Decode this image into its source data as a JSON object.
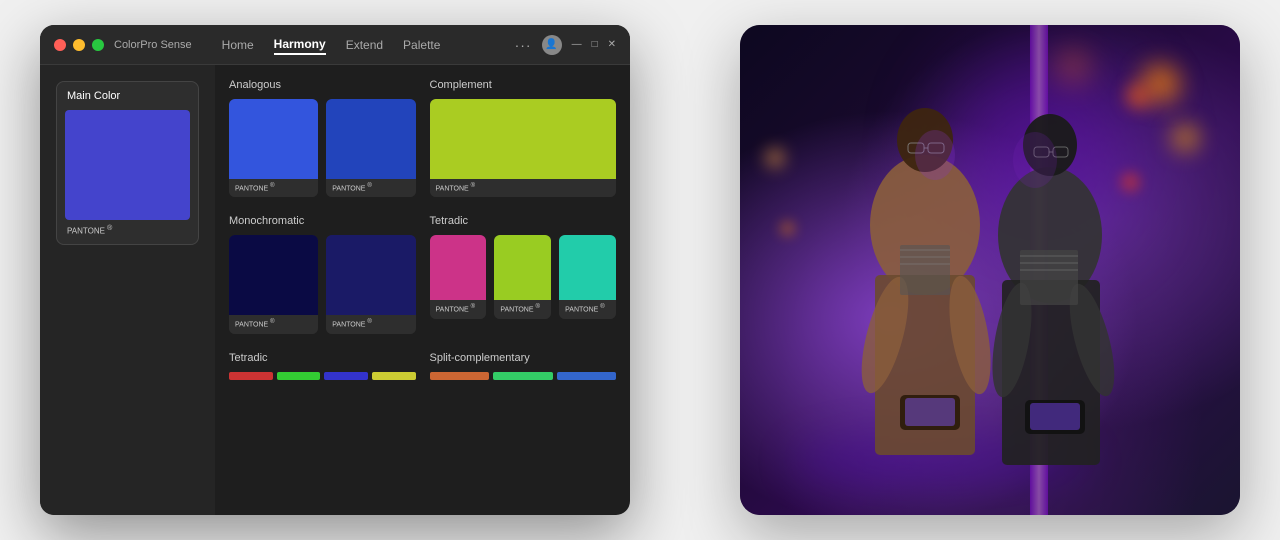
{
  "app": {
    "title": "ColorPro Sense",
    "nav": {
      "tabs": [
        {
          "label": "Home",
          "active": false
        },
        {
          "label": "Harmony",
          "active": true
        },
        {
          "label": "Extend",
          "active": false
        },
        {
          "label": "Palette",
          "active": false
        }
      ]
    },
    "window_controls": {
      "dots": "···"
    }
  },
  "sidebar": {
    "main_color_label": "Main Color",
    "pantone_label": "PANTONE",
    "pantone_reg": "®",
    "main_color": "#4444cc"
  },
  "sections": [
    {
      "id": "analogous",
      "title": "Analogous",
      "swatches": [
        {
          "color": "#3355dd",
          "pantone": "PANTONE",
          "reg": "®"
        },
        {
          "color": "#2244bb",
          "pantone": "PANTONE",
          "reg": "®"
        }
      ]
    },
    {
      "id": "complement",
      "title": "Complement",
      "swatches": [
        {
          "color": "#aacc22",
          "pantone": "PANTONE",
          "reg": "®"
        }
      ]
    },
    {
      "id": "monochromatic",
      "title": "Monochromatic",
      "swatches": [
        {
          "color": "#0a0a44",
          "pantone": "PANTONE",
          "reg": "®"
        },
        {
          "color": "#1a1a66",
          "pantone": "PANTONE",
          "reg": "®"
        }
      ]
    },
    {
      "id": "tetradic",
      "title": "Tetradic",
      "swatches": [
        {
          "color": "#cc3388",
          "pantone": "PANTONE",
          "reg": "®"
        },
        {
          "color": "#99cc22",
          "pantone": "PANTONE",
          "reg": "®"
        },
        {
          "color": "#22ccaa",
          "pantone": "PANTONE",
          "reg": "®"
        }
      ]
    },
    {
      "id": "tetradic2",
      "title": "Tetradic",
      "bars": [
        {
          "color": "#cc3333"
        },
        {
          "color": "#33cc33"
        },
        {
          "color": "#3333cc"
        },
        {
          "color": "#cccc33"
        }
      ]
    },
    {
      "id": "split_complementary",
      "title": "Split-complementary",
      "bars": [
        {
          "color": "#cc6633"
        },
        {
          "color": "#33cc66"
        },
        {
          "color": "#3366cc"
        }
      ]
    }
  ]
}
